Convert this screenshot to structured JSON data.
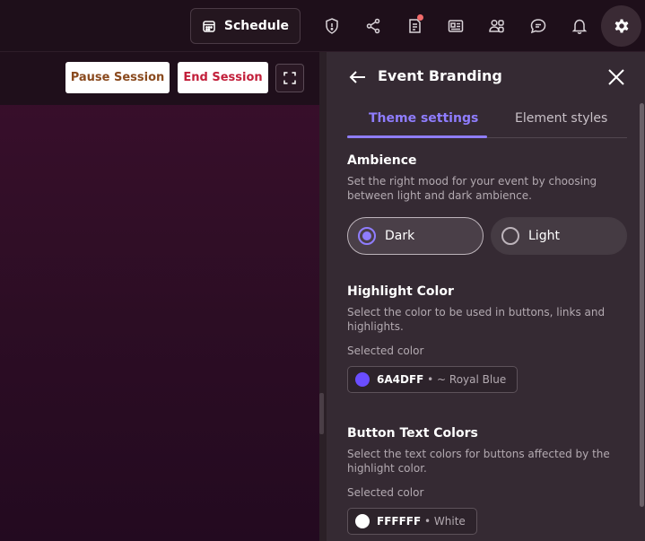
{
  "topbar": {
    "schedule_label": "Schedule",
    "icons": [
      "shield-icon",
      "share-icon",
      "notes-icon",
      "news-icon",
      "people-icon",
      "chat-icon",
      "bell-icon",
      "gear-icon"
    ]
  },
  "stage": {
    "pause_label": "Pause Session",
    "end_label": "End Session"
  },
  "panel": {
    "title": "Event Branding",
    "tabs": [
      {
        "label": "Theme settings",
        "active": true
      },
      {
        "label": "Element styles",
        "active": false
      }
    ],
    "ambience": {
      "title": "Ambience",
      "description": "Set the right mood for your event by choosing between light and dark ambience.",
      "options": [
        {
          "label": "Dark",
          "selected": true
        },
        {
          "label": "Light",
          "selected": false
        }
      ]
    },
    "highlight": {
      "title": "Highlight Color",
      "description": "Select the color to be used in buttons, links and highlights.",
      "selected_label": "Selected color",
      "hex": "6A4DFF",
      "name": " • ~ Royal Blue",
      "swatch": "#6A4DFF"
    },
    "button_text": {
      "title": "Button Text Colors",
      "description": "Select the text colors for buttons affected by the highlight color.",
      "selected_label": "Selected color",
      "hex": "FFFFFF",
      "name": " • White",
      "swatch": "#FFFFFF"
    }
  },
  "colors": {
    "accent": "#8F7DFF",
    "panel_bg": "#352A33",
    "topbar_bg": "#1E0F1A"
  }
}
